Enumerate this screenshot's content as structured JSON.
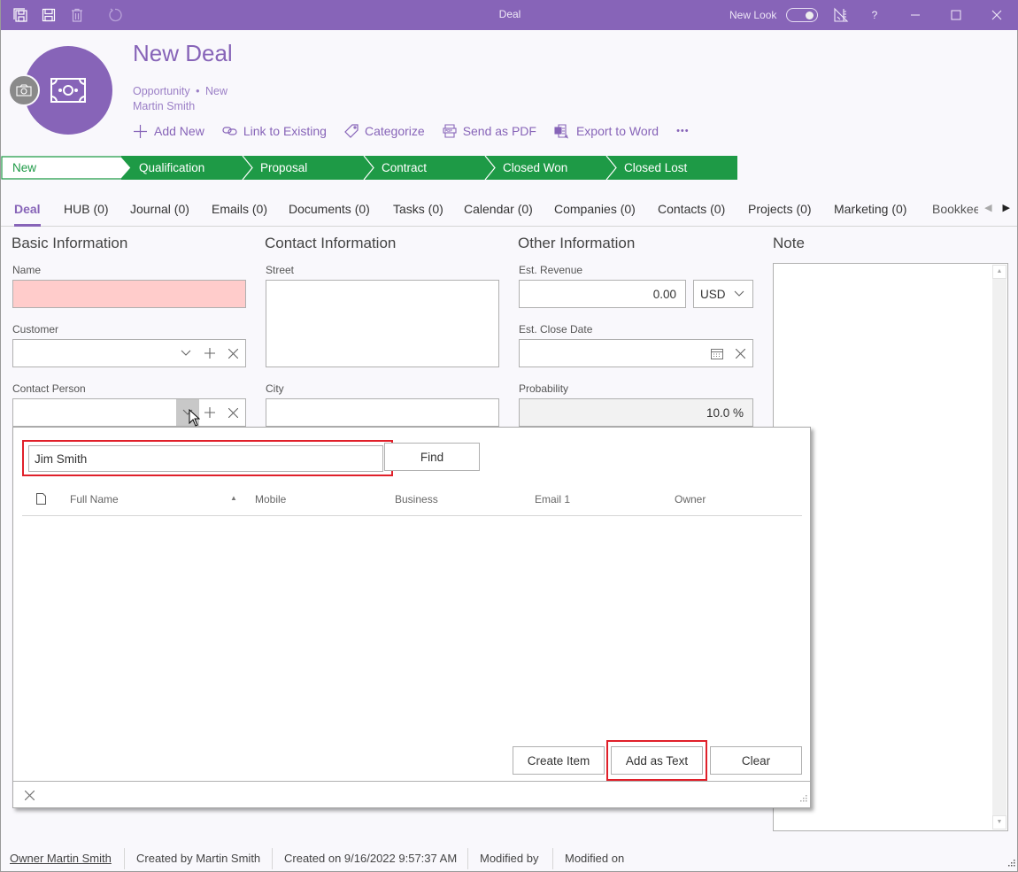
{
  "titlebar": {
    "title": "Deal",
    "new_look_label": "New Look",
    "new_look_on": true,
    "help_label": "?",
    "colors": {
      "bar": "#8764b8"
    }
  },
  "header": {
    "title": "New Deal",
    "type": "Opportunity",
    "separator": "•",
    "status": "New",
    "owner": "Martin Smith",
    "actions": [
      {
        "label": "Add New",
        "icon": "plus-icon"
      },
      {
        "label": "Link to Existing",
        "icon": "link-icon"
      },
      {
        "label": "Categorize",
        "icon": "tag-icon"
      },
      {
        "label": "Send as PDF",
        "icon": "pdf-icon"
      },
      {
        "label": "Export to Word",
        "icon": "word-icon"
      }
    ],
    "more_label": "•••"
  },
  "stages": {
    "items": [
      "New",
      "Qualification",
      "Proposal",
      "Contract",
      "Closed Won",
      "Closed Lost"
    ],
    "current": "New",
    "colors": {
      "active_bg": "#ffffff",
      "active_text": "#1e9a46",
      "bg": "#1e9a46"
    }
  },
  "tabs": {
    "items": [
      "Deal",
      "HUB (0)",
      "Journal (0)",
      "Emails (0)",
      "Documents (0)",
      "Tasks (0)",
      "Calendar (0)",
      "Companies (0)",
      "Contacts (0)",
      "Projects (0)",
      "Marketing (0)",
      "Bookkee"
    ],
    "active": "Deal"
  },
  "basic": {
    "heading": "Basic Information",
    "name_label": "Name",
    "name_value": "",
    "customer_label": "Customer",
    "customer_value": "",
    "contact_label": "Contact Person",
    "contact_value": ""
  },
  "contact": {
    "heading": "Contact Information",
    "street_label": "Street",
    "street_value": "",
    "city_label": "City",
    "city_value": ""
  },
  "other": {
    "heading": "Other Information",
    "revenue_label": "Est. Revenue",
    "revenue_value": "0.00",
    "currency": "USD",
    "close_date_label": "Est. Close Date",
    "close_date_value": "",
    "probability_label": "Probability",
    "probability_value": "10.0 %"
  },
  "note": {
    "heading": "Note",
    "value": ""
  },
  "lookup": {
    "search_value": "Jim Smith",
    "find_label": "Find",
    "columns": [
      "Full Name",
      "Mobile",
      "Business",
      "Email 1",
      "Owner"
    ],
    "sorted_column": "Full Name",
    "rows": [],
    "create_label": "Create Item",
    "add_text_label": "Add as Text",
    "clear_label": "Clear"
  },
  "statusbar": {
    "owner": "Owner Martin Smith",
    "created_by": "Created by Martin Smith",
    "created_on": "Created on 9/16/2022 9:57:37 AM",
    "modified_by": "Modified by",
    "modified_on": "Modified on"
  }
}
